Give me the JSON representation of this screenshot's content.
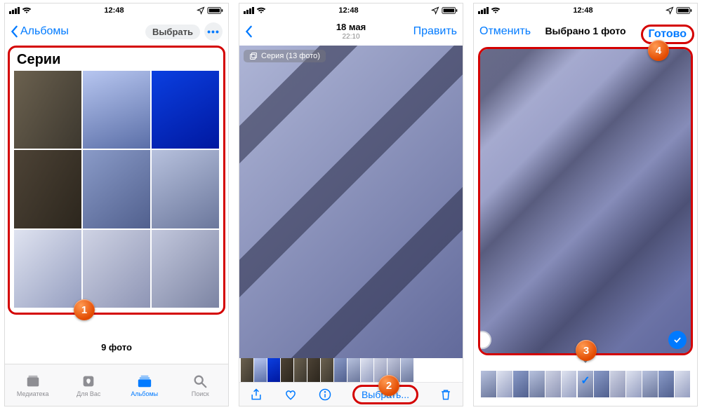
{
  "statusbar": {
    "time": "12:48"
  },
  "screen1": {
    "nav": {
      "back": "Альбомы",
      "choose": "Выбрать"
    },
    "album_title": "Серии",
    "count_label": "9 фото",
    "tabs": {
      "library": "Медиатека",
      "foryou": "Для Вас",
      "albums": "Альбомы",
      "search": "Поиск"
    },
    "step": "1"
  },
  "screen2": {
    "nav": {
      "date": "18 мая",
      "time": "22:10",
      "edit": "Править"
    },
    "burst_label": "Серия (13 фото)",
    "select_label": "Выбрать...",
    "step": "2"
  },
  "screen3": {
    "nav": {
      "cancel": "Отменить",
      "title": "Выбрано 1 фото",
      "done": "Готово"
    },
    "step_photo": "3",
    "step_done": "4"
  }
}
